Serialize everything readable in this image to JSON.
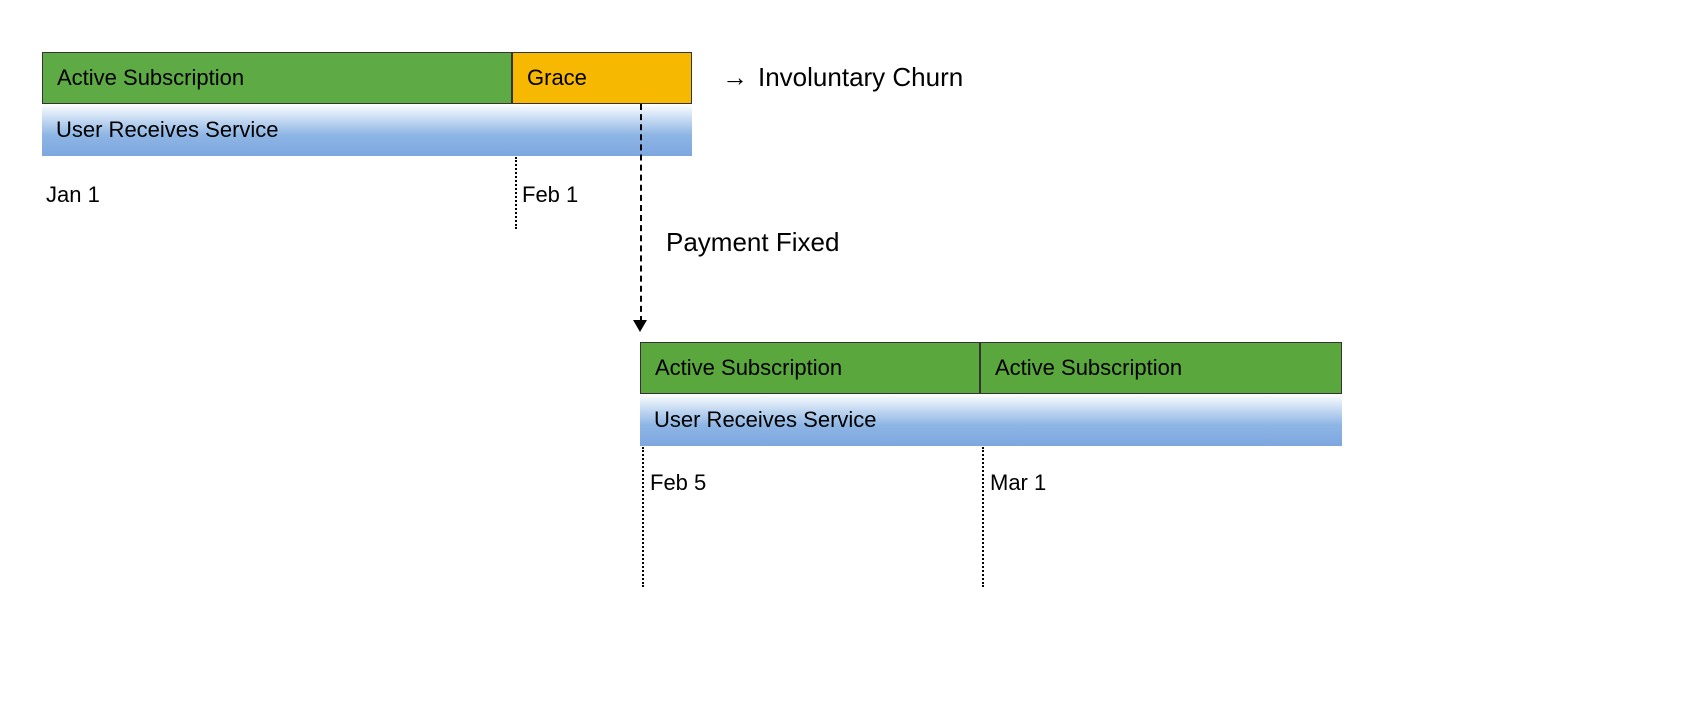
{
  "top_timeline": {
    "active": {
      "label": "Active Subscription"
    },
    "grace": {
      "label": "Grace"
    },
    "service": {
      "label": "User Receives Service"
    },
    "dates": {
      "jan1": "Jan 1",
      "feb1": "Feb 1"
    }
  },
  "annotations": {
    "churn_arrow": "→",
    "churn": "Involuntary Churn",
    "payment_fixed": "Payment Fixed"
  },
  "bottom_timeline": {
    "active1": {
      "label": "Active Subscription"
    },
    "active2": {
      "label": "Active Subscription"
    },
    "service": {
      "label": "User Receives Service"
    },
    "dates": {
      "feb5": "Feb 5",
      "mar1": "Mar 1"
    }
  },
  "colors": {
    "green": "#5eaa44",
    "yellow": "#f6b800",
    "blue_grad_start": "#ffffff",
    "blue_grad_end": "#7ea7e0"
  }
}
